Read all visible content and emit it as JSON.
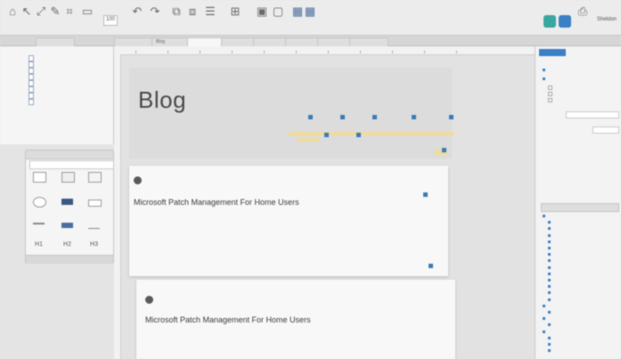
{
  "toolbar": {
    "zoom": "100",
    "user": "Sheldon",
    "buttons": [
      "",
      "",
      "",
      "",
      "",
      "",
      "",
      "",
      "",
      "",
      "",
      "",
      "",
      "",
      "",
      "",
      "",
      ""
    ]
  },
  "tabs": [
    "",
    "",
    "Blog",
    "",
    "",
    "",
    "",
    "",
    ""
  ],
  "pages": [
    "",
    "",
    "",
    "",
    "",
    "",
    "",
    ""
  ],
  "library": {
    "header": "",
    "selected": "",
    "footer": "",
    "widgets": [
      "",
      "",
      "",
      "",
      "",
      "",
      "",
      "",
      "",
      "",
      "",
      ""
    ]
  },
  "canvas": {
    "blog_title": "Blog",
    "nav_links": [
      "",
      "",
      "",
      "",
      ""
    ],
    "posts": [
      {
        "author": "",
        "title": "Microsoft Patch Management For Home Users",
        "date": "",
        "body": ""
      },
      {
        "author": "",
        "title": "Microsoft Patch Management For Home Users",
        "date": "",
        "body": ""
      }
    ]
  },
  "inspector": {
    "tabs": [
      "",
      "",
      ""
    ],
    "rows": [
      "",
      "",
      "",
      "",
      "",
      "",
      ""
    ],
    "outline_header": "",
    "tree": [
      "",
      "",
      "",
      "",
      "",
      "",
      "",
      "",
      "",
      "",
      "",
      "",
      "",
      "",
      "",
      "",
      "",
      "",
      "",
      "",
      "",
      ""
    ]
  },
  "colors": {
    "accent": "#3b7fc4",
    "highlight": "#f0dc9a",
    "link": "#6f9cc5"
  }
}
